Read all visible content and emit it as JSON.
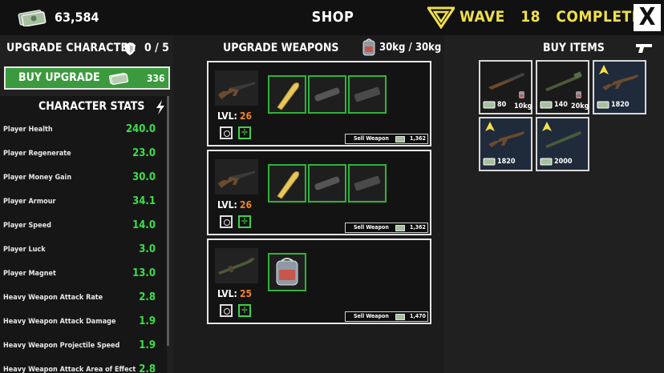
{
  "header": {
    "money": "63,584",
    "title": "SHOP",
    "wave_label": "WAVE",
    "wave_number": "18",
    "wave_status": "COMPLETE",
    "close_label": "X"
  },
  "character": {
    "title": "UPGRADE CHARACTER",
    "upgrades": "0 / 5",
    "buy_label": "BUY UPGRADE",
    "buy_cost": "336",
    "stats_title": "CHARACTER STATS",
    "stats": [
      {
        "name": "Player Health",
        "value": "240.0"
      },
      {
        "name": "Player Regenerate",
        "value": "23.0"
      },
      {
        "name": "Player Money Gain",
        "value": "30.0"
      },
      {
        "name": "Player Armour",
        "value": "34.1"
      },
      {
        "name": "Player Speed",
        "value": "14.0"
      },
      {
        "name": "Player Luck",
        "value": "3.0"
      },
      {
        "name": "Player Magnet",
        "value": "13.0"
      },
      {
        "name": "Heavy Weapon Attack Rate",
        "value": "2.8"
      },
      {
        "name": "Heavy Weapon Attack Damage",
        "value": "1.9"
      },
      {
        "name": "Heavy Weapon Projectile Speed",
        "value": "1.9"
      },
      {
        "name": "Heavy Weapon Attack Area of Effect",
        "value": "2.8"
      }
    ]
  },
  "weapons": {
    "title": "UPGRADE WEAPONS",
    "weight": "30kg /  30kg",
    "cards": [
      {
        "lvl_label": "LVL:",
        "level": "26",
        "sell_label": "Sell Weapon",
        "sell_price": "1,362"
      },
      {
        "lvl_label": "LVL:",
        "level": "26",
        "sell_label": "Sell Weapon",
        "sell_price": "1,362"
      },
      {
        "lvl_label": "LVL:",
        "level": "25",
        "sell_label": "Sell Weapon",
        "sell_price": "1,470"
      }
    ]
  },
  "shop": {
    "title": "BUY ITEMS",
    "items": [
      {
        "price": "80",
        "weight": "10kg"
      },
      {
        "price": "140",
        "weight": "20kg"
      },
      {
        "price": "1820",
        "weight": ""
      },
      {
        "price": "1820",
        "weight": ""
      },
      {
        "price": "2000",
        "weight": ""
      }
    ]
  },
  "colors": {
    "accent_green": "#39e04a",
    "wave_yellow": "#f0e04a",
    "level_orange": "#f2832b",
    "upgrade_arrow": "#f5e04a"
  }
}
